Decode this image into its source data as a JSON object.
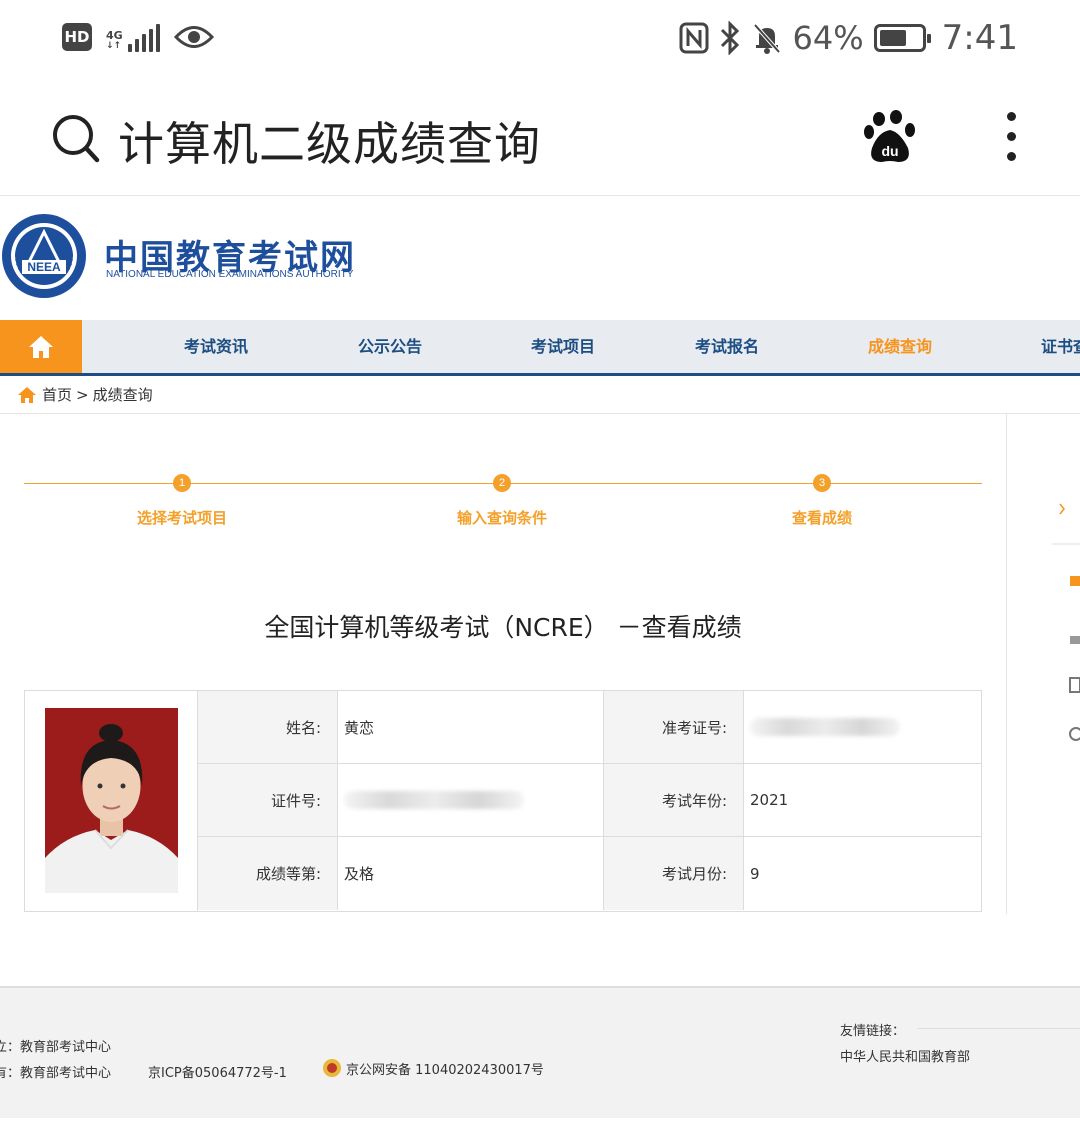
{
  "status_bar": {
    "hd": "HD",
    "network": "4G",
    "battery_pct": "64%",
    "battery_level": 0.64,
    "time": "7:41"
  },
  "search": {
    "query": "计算机二级成绩查询"
  },
  "site": {
    "name_cn": "中国教育考试网",
    "name_en": "NATIONAL EDUCATION EXAMINATIONS AUTHORITY",
    "emblem_text": "NEEA"
  },
  "nav": {
    "items": [
      {
        "label": "考试资讯"
      },
      {
        "label": "公示公告"
      },
      {
        "label": "考试项目"
      },
      {
        "label": "考试报名"
      },
      {
        "label": "成绩查询",
        "active": true
      },
      {
        "label": "证书查"
      }
    ]
  },
  "breadcrumb": {
    "home": "首页",
    "separator": ">",
    "current": "成绩查询"
  },
  "steps": [
    {
      "num": "1",
      "label": "选择考试项目"
    },
    {
      "num": "2",
      "label": "输入查询条件"
    },
    {
      "num": "3",
      "label": "查看成绩"
    }
  ],
  "page_title": "全国计算机等级考试（NCRE） －查看成绩",
  "result": {
    "name_label": "姓名:",
    "name_value": "黄恋",
    "ticket_label": "准考证号:",
    "id_label": "证件号:",
    "year_label": "考试年份:",
    "year_value": "2021",
    "grade_label": "成绩等第:",
    "grade_value": "及格",
    "month_label": "考试月份:",
    "month_value": "9"
  },
  "footer": {
    "line1": "立：教育部考试中心",
    "line2": "有：教育部考试中心",
    "icp": "京ICP备05064772号-1",
    "police": "京公网安备 11040202430017号",
    "links_title": "友情链接：",
    "link1": "中华人民共和国教育部"
  },
  "colors": {
    "accent": "#f7941d",
    "brand": "#1c4e83",
    "photo_bg": "#9c1b1b"
  }
}
